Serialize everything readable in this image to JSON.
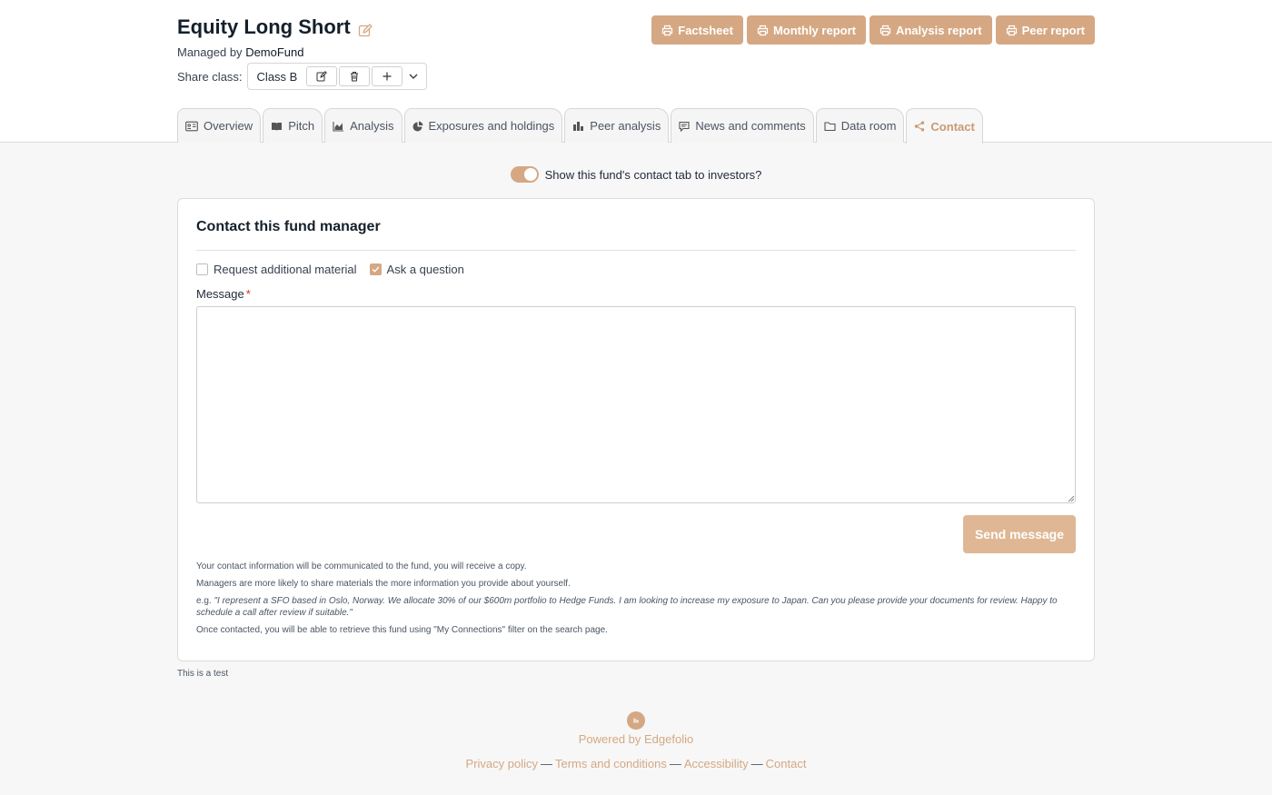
{
  "header": {
    "fund_name": "Equity Long Short",
    "managed_by_prefix": "Managed by",
    "manager_name": "DemoFund",
    "share_class_label": "Share class:",
    "share_class_value": "Class B"
  },
  "reports": [
    {
      "label": "Factsheet",
      "icon": "printer-icon"
    },
    {
      "label": "Monthly report",
      "icon": "printer-icon"
    },
    {
      "label": "Analysis report",
      "icon": "printer-icon"
    },
    {
      "label": "Peer report",
      "icon": "printer-icon"
    }
  ],
  "tabs": [
    {
      "label": "Overview",
      "icon": "id-card-icon"
    },
    {
      "label": "Pitch",
      "icon": "book-icon"
    },
    {
      "label": "Analysis",
      "icon": "area-chart-icon"
    },
    {
      "label": "Exposures and holdings",
      "icon": "pie-chart-icon"
    },
    {
      "label": "Peer analysis",
      "icon": "bar-chart-icon"
    },
    {
      "label": "News and comments",
      "icon": "comment-icon"
    },
    {
      "label": "Data room",
      "icon": "folder-icon"
    },
    {
      "label": "Contact",
      "icon": "share-icon",
      "active": true
    }
  ],
  "toggle": {
    "label": "Show this fund's contact tab to investors?",
    "on": true
  },
  "contact": {
    "title": "Contact this fund manager",
    "checkbox_material": "Request additional material",
    "checkbox_material_checked": false,
    "checkbox_question": "Ask a question",
    "checkbox_question_checked": true,
    "message_label": "Message",
    "required_mark": "*",
    "message_value": "",
    "send_label": "Send message",
    "note1": "Your contact information will be communicated to the fund, you will receive a copy.",
    "note2": "Managers are more likely to share materials the more information you provide about yourself.",
    "note3_prefix": "e.g. ",
    "note3_example": "\"I represent a SFO based in Oslo, Norway. We allocate 30% of our $600m portfolio to Hedge Funds. I am looking to increase my exposure to Japan. Can you please provide your documents for review. Happy to schedule a call after review if suitable.\"",
    "note4": "Once contacted, you will be able to retrieve this fund using \"My Connections\" filter on the search page."
  },
  "test_note": "This is a test",
  "footer": {
    "powered_by": "Powered by Edgefolio",
    "links": [
      "Privacy policy",
      "Terms and conditions",
      "Accessibility",
      "Contact"
    ],
    "separator": "—"
  },
  "colors": {
    "accent": "#d5a883",
    "accent_light": "#dfb795",
    "title": "#14202b"
  }
}
